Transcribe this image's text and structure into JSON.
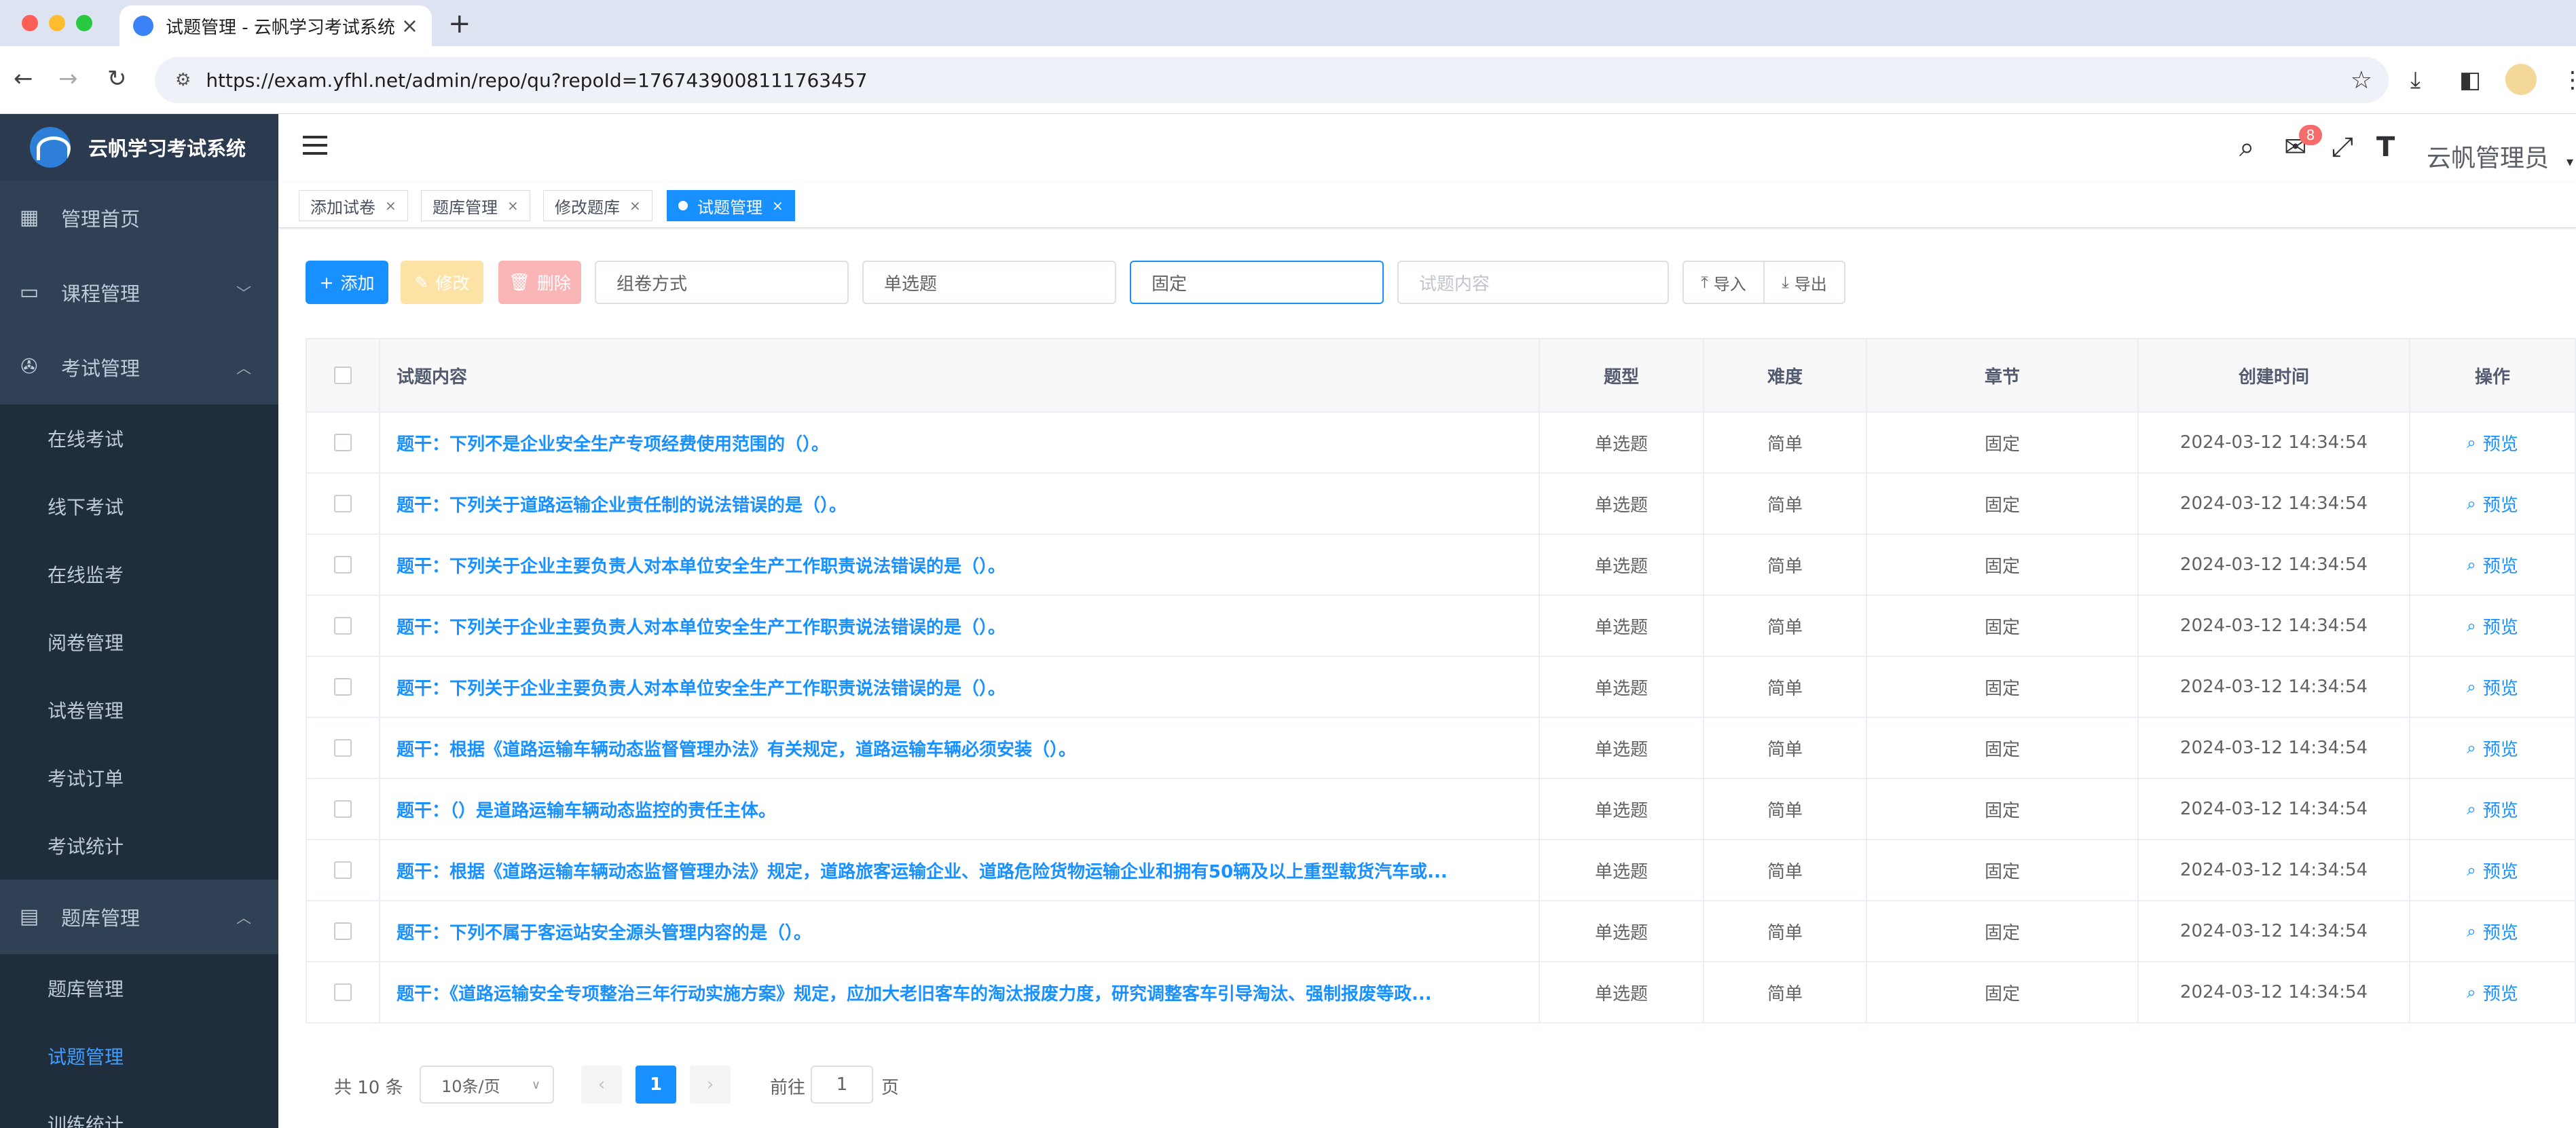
{
  "browser": {
    "tab_title": "试题管理 - 云帆学习考试系统",
    "url": "https://exam.yfhl.net/admin/repo/qu?repoId=1767439008111763457"
  },
  "sidebar": {
    "app_name": "云帆学习考试系统",
    "menu": [
      {
        "label": "管理首页",
        "icon": "dashboard-icon"
      },
      {
        "label": "课程管理",
        "icon": "monitor-icon"
      },
      {
        "label": "考试管理",
        "icon": "aperture-icon"
      }
    ],
    "exam_sub": [
      "在线考试",
      "线下考试",
      "在线监考",
      "阅卷管理",
      "试卷管理",
      "考试订单",
      "考试统计"
    ],
    "repo_menu": {
      "label": "题库管理",
      "icon": "document-icon"
    },
    "repo_sub": [
      "题库管理",
      "试题管理",
      "训练统计"
    ]
  },
  "header": {
    "notification_count": "8",
    "username": "云帆管理员"
  },
  "tags": [
    {
      "label": "添加试卷"
    },
    {
      "label": "题库管理"
    },
    {
      "label": "修改题库"
    },
    {
      "label": "试题管理"
    }
  ],
  "toolbar": {
    "add": "添加",
    "edit": "修改",
    "delete": "删除",
    "filter_method": "组卷方式",
    "filter_type": "单选题",
    "filter_chapter": "固定",
    "search_placeholder": "试题内容",
    "import": "导入",
    "export": "导出"
  },
  "table": {
    "columns": [
      "试题内容",
      "题型",
      "难度",
      "章节",
      "创建时间",
      "操作"
    ],
    "preview_label": "预览",
    "rows": [
      {
        "content": "题干：下列不是企业安全生产专项经费使用范围的（）。",
        "type": "单选题",
        "difficulty": "简单",
        "chapter": "固定",
        "created": "2024-03-12 14:34:54"
      },
      {
        "content": "题干：下列关于道路运输企业责任制的说法错误的是（）。",
        "type": "单选题",
        "difficulty": "简单",
        "chapter": "固定",
        "created": "2024-03-12 14:34:54"
      },
      {
        "content": "题干：下列关于企业主要负责人对本单位安全生产工作职责说法错误的是（）。",
        "type": "单选题",
        "difficulty": "简单",
        "chapter": "固定",
        "created": "2024-03-12 14:34:54"
      },
      {
        "content": "题干：下列关于企业主要负责人对本单位安全生产工作职责说法错误的是（）。",
        "type": "单选题",
        "difficulty": "简单",
        "chapter": "固定",
        "created": "2024-03-12 14:34:54"
      },
      {
        "content": "题干：下列关于企业主要负责人对本单位安全生产工作职责说法错误的是（）。",
        "type": "单选题",
        "difficulty": "简单",
        "chapter": "固定",
        "created": "2024-03-12 14:34:54"
      },
      {
        "content": "题干：根据《道路运输车辆动态监督管理办法》有关规定，道路运输车辆必须安装（）。",
        "type": "单选题",
        "difficulty": "简单",
        "chapter": "固定",
        "created": "2024-03-12 14:34:54"
      },
      {
        "content": "题干：（）是道路运输车辆动态监控的责任主体。",
        "type": "单选题",
        "difficulty": "简单",
        "chapter": "固定",
        "created": "2024-03-12 14:34:54"
      },
      {
        "content": "题干：根据《道路运输车辆动态监督管理办法》规定，道路旅客运输企业、道路危险货物运输企业和拥有50辆及以上重型载货汽车或...",
        "type": "单选题",
        "difficulty": "简单",
        "chapter": "固定",
        "created": "2024-03-12 14:34:54"
      },
      {
        "content": "题干：下列不属于客运站安全源头管理内容的是（）。",
        "type": "单选题",
        "difficulty": "简单",
        "chapter": "固定",
        "created": "2024-03-12 14:34:54"
      },
      {
        "content": "题干：《道路运输安全专项整治三年行动实施方案》规定，应加大老旧客车的淘汰报废力度，研究调整客车引导淘汰、强制报废等政...",
        "type": "单选题",
        "difficulty": "简单",
        "chapter": "固定",
        "created": "2024-03-12 14:34:54"
      }
    ]
  },
  "pagination": {
    "total": "共 10 条",
    "page_size": "10条/页",
    "current_page": "1",
    "goto_prefix": "前往",
    "goto_value": "1",
    "goto_suffix": "页"
  }
}
